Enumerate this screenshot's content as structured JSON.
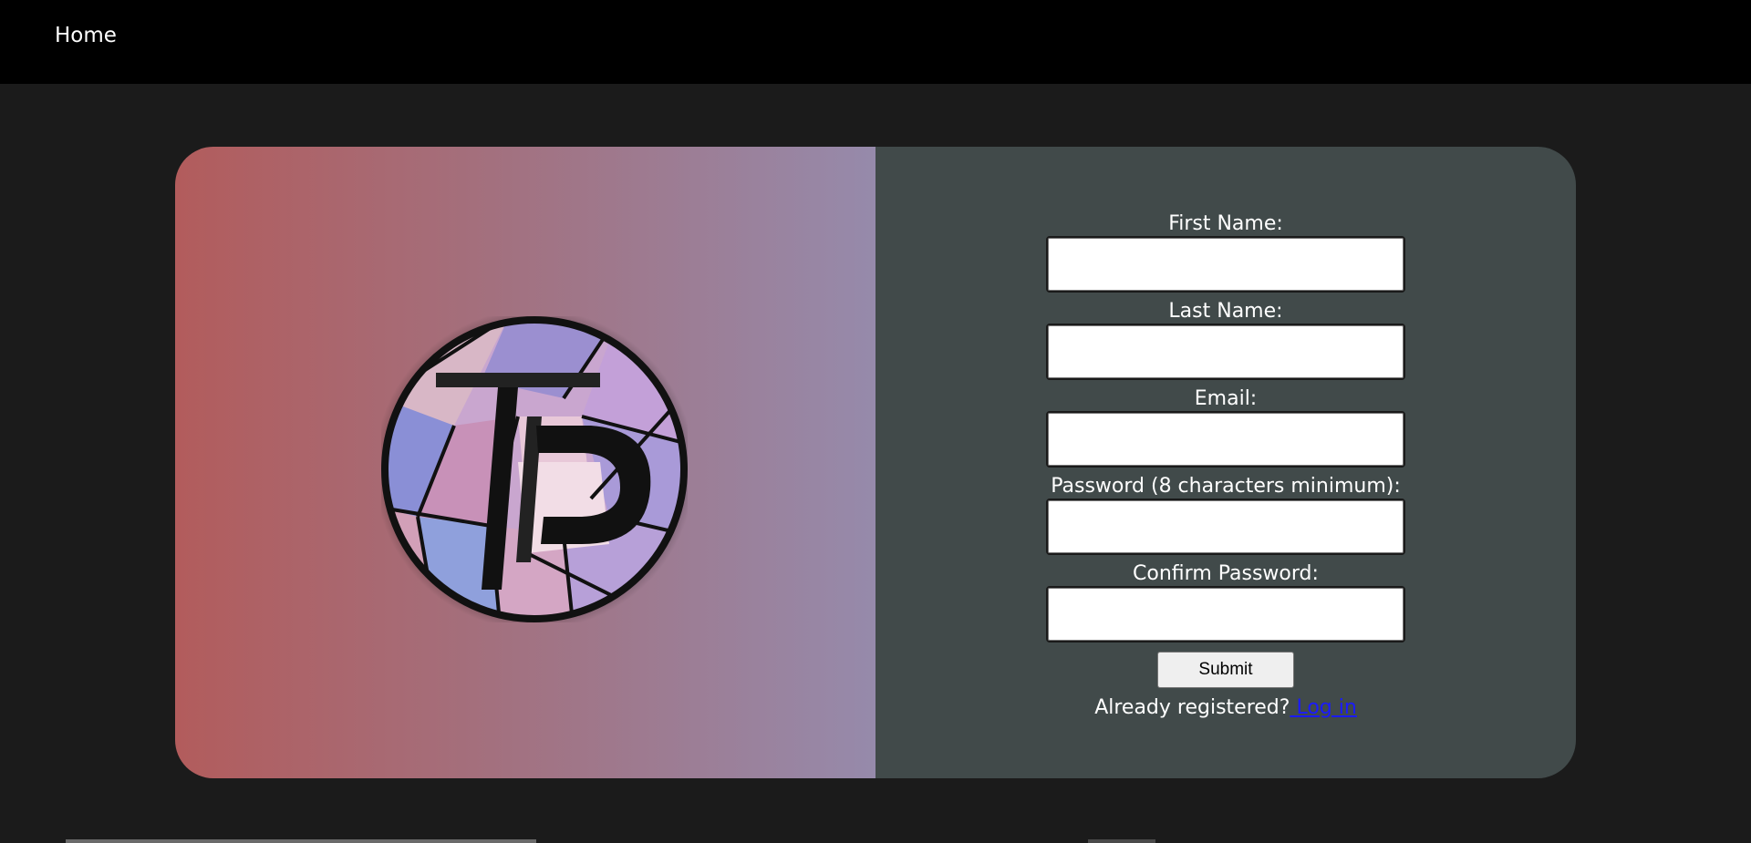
{
  "nav": {
    "home_label": "Home"
  },
  "form": {
    "fields": [
      {
        "label": "First Name:",
        "value": ""
      },
      {
        "label": "Last Name:",
        "value": ""
      },
      {
        "label": "Email:",
        "value": ""
      },
      {
        "label": "Password (8 characters minimum):",
        "value": ""
      },
      {
        "label": "Confirm Password:",
        "value": ""
      }
    ],
    "submit_label": "Submit",
    "login_prompt": "Already registered?",
    "login_link": " Log in"
  },
  "logo": {
    "icon": "tp-stained-glass-logo",
    "text": "TP"
  },
  "colors": {
    "page_bg": "#1b1b1b",
    "nav_bg": "#000000",
    "panel_right": "#414a4a",
    "gradient_start": "#b25c5c",
    "gradient_end": "#968aab",
    "link": "#1a1aff"
  }
}
